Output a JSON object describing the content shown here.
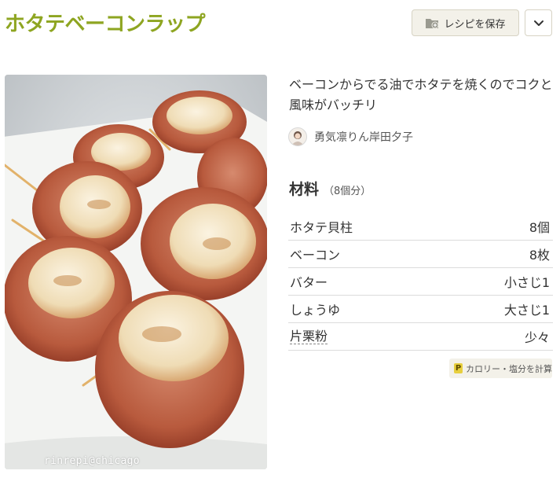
{
  "recipe": {
    "title": "ホタテベーコンラップ",
    "description": "ベーコンからでる油でホタテを焼くのでコクと風味がバッチリ",
    "author": "勇気凛りん岸田夕子",
    "photo_watermark": "rinrepi@chicago"
  },
  "actions": {
    "save_label": "レシピを保存",
    "calc_label": "カロリー・塩分を計算",
    "calc_badge": "P"
  },
  "ingredients": {
    "heading": "材料",
    "servings": "（8個分）",
    "items": [
      {
        "name": "ホタテ貝柱",
        "amount": "8個"
      },
      {
        "name": "ベーコン",
        "amount": "8枚"
      },
      {
        "name": "バター",
        "amount": "小さじ1"
      },
      {
        "name": "しょうゆ",
        "amount": "大さじ1"
      },
      {
        "name": "片栗粉",
        "amount": "少々"
      }
    ]
  },
  "colors": {
    "title": "#8ea521",
    "button_bg": "#f3f1e9",
    "badge": "#e7cf3e"
  },
  "icons": [
    "folder-plus-icon",
    "chevron-down-icon",
    "avatar",
    "p-badge-icon"
  ]
}
